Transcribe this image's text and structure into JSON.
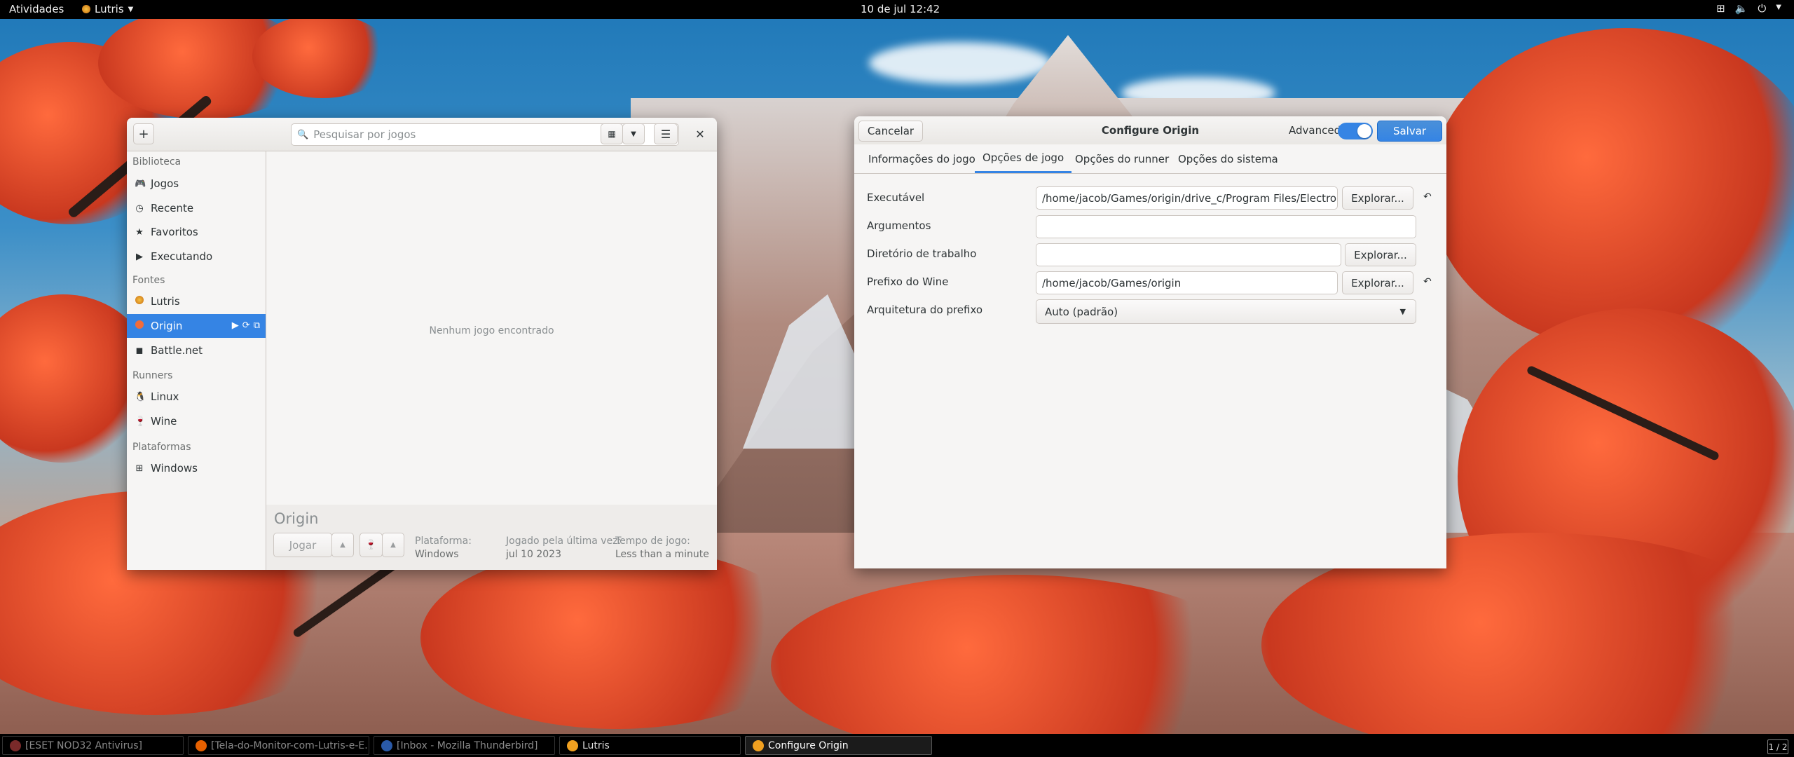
{
  "topbar": {
    "activities": "Atividades",
    "app_menu": "Lutris",
    "clock": "10 de jul  12:42"
  },
  "lutris": {
    "add_label": "+",
    "search_placeholder": "Pesquisar por jogos",
    "sidebar": {
      "sections": {
        "library": "Biblioteca",
        "sources": "Fontes",
        "runners": "Runners",
        "platforms": "Plataformas"
      },
      "library_items": [
        {
          "label": "Jogos",
          "icon": "gamepad-icon"
        },
        {
          "label": "Recente",
          "icon": "clock-icon"
        },
        {
          "label": "Favoritos",
          "icon": "star-icon"
        },
        {
          "label": "Executando",
          "icon": "play-icon"
        }
      ],
      "source_items": [
        {
          "label": "Lutris",
          "icon": "lutris-icon"
        },
        {
          "label": "Origin",
          "icon": "origin-icon",
          "selected": true
        },
        {
          "label": "Battle.net",
          "icon": "battlenet-icon"
        }
      ],
      "runner_items": [
        {
          "label": "Linux",
          "icon": "linux-icon"
        },
        {
          "label": "Wine",
          "icon": "wine-icon"
        }
      ],
      "platform_items": [
        {
          "label": "Windows",
          "icon": "windows-icon"
        }
      ]
    },
    "empty_message": "Nenhum jogo encontrado",
    "detail": {
      "title": "Origin",
      "play_button": "Jogar",
      "platform_label": "Plataforma:",
      "platform_value": "Windows",
      "last_played_label": "Jogado pela última vez:",
      "last_played_value": "jul 10 2023",
      "playtime_label": "Tempo de jogo:",
      "playtime_value": "Less than a minute"
    }
  },
  "config": {
    "title": "Configure Origin",
    "cancel": "Cancelar",
    "advanced_label": "Advanced",
    "advanced_on": true,
    "save": "Salvar",
    "tabs": [
      {
        "label": "Informações do jogo"
      },
      {
        "label": "Opções de jogo",
        "active": true
      },
      {
        "label": "Opções do runner"
      },
      {
        "label": "Opções do sistema"
      }
    ],
    "fields": {
      "executable": {
        "label": "Executável",
        "value": "/home/jacob/Games/origin/drive_c/Program Files/Electronic A",
        "browse": "Explorar..."
      },
      "arguments": {
        "label": "Argumentos",
        "value": ""
      },
      "workdir": {
        "label": "Diretório de trabalho",
        "value": "",
        "browse": "Explorar..."
      },
      "wineprefix": {
        "label": "Prefixo do Wine",
        "value": "/home/jacob/Games/origin",
        "browse": "Explorar..."
      },
      "arch": {
        "label": "Arquitetura do prefixo",
        "value": "Auto (padrão)"
      }
    }
  },
  "taskbar": {
    "items": [
      {
        "label": "[ESET NOD32 Antivirus]",
        "icon_color": "#7a2a2a"
      },
      {
        "label": "[Tela-do-Monitor-com-Lutris-e-E...",
        "icon_color": "#e66000"
      },
      {
        "label": "[Inbox - Mozilla Thunderbird]",
        "icon_color": "#2a5aa8"
      },
      {
        "label": "Lutris",
        "icon_color": "#f0a020"
      },
      {
        "label": "Configure Origin",
        "icon_color": "#f0a020",
        "active": true
      }
    ],
    "workspace": "1 / 2"
  },
  "colors": {
    "accent": "#3584e4",
    "window_bg": "#f6f5f4",
    "topbar_bg": "#000000"
  }
}
